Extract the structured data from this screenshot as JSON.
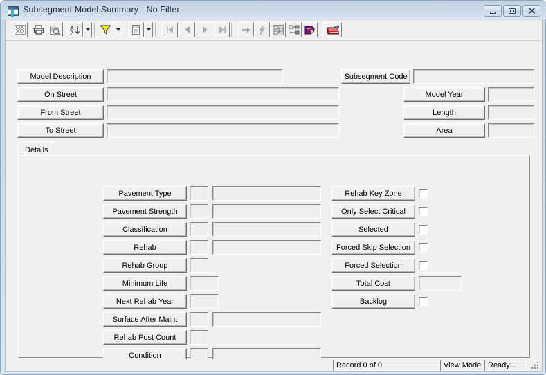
{
  "window": {
    "title": "Subsegment Model Summary - No Filter",
    "icon": "table-grid-icon",
    "controls": {
      "minimize": "Minimize",
      "maximize": "Maximize",
      "close": "Close"
    }
  },
  "toolbar": {
    "buttons": [
      {
        "name": "select-all-icon",
        "glyph": "grid"
      },
      {
        "name": "print-icon",
        "glyph": "printer"
      },
      {
        "name": "print-preview-icon",
        "glyph": "preview"
      },
      {
        "name": "sort-icon",
        "glyph": "sort"
      },
      {
        "name": "filter-icon",
        "glyph": "funnel"
      },
      {
        "name": "report-icon",
        "glyph": "document"
      },
      {
        "name": "first-record-icon",
        "glyph": "first"
      },
      {
        "name": "previous-record-icon",
        "glyph": "prev"
      },
      {
        "name": "next-record-icon",
        "glyph": "next"
      },
      {
        "name": "last-record-icon",
        "glyph": "last"
      },
      {
        "name": "goto-record-icon",
        "glyph": "arrow-right"
      },
      {
        "name": "lightning-icon",
        "glyph": "lightning"
      },
      {
        "name": "hierarchy-icon",
        "glyph": "hierarchy"
      },
      {
        "name": "tree-view-icon",
        "glyph": "tree"
      },
      {
        "name": "help-book-icon",
        "glyph": "book"
      },
      {
        "name": "map-icon",
        "glyph": "map"
      }
    ],
    "dropdown_label": "More options"
  },
  "header_form": {
    "left_fields": [
      {
        "label": "Model Description",
        "value": "",
        "placeholder": ""
      },
      {
        "label": "On Street",
        "value": "",
        "placeholder": ""
      },
      {
        "label": "From Street",
        "value": "",
        "placeholder": ""
      },
      {
        "label": "To Street",
        "value": "",
        "placeholder": ""
      }
    ],
    "right_fields": [
      {
        "label": "Subsegment Code",
        "value": "",
        "placeholder": ""
      },
      {
        "label": "Model Year",
        "value": "",
        "placeholder": ""
      },
      {
        "label": "Length",
        "value": "",
        "placeholder": ""
      },
      {
        "label": "Area",
        "value": "",
        "placeholder": ""
      }
    ]
  },
  "tabs": [
    {
      "label": "Details",
      "active": true
    }
  ],
  "details": {
    "left_column": [
      {
        "label": "Pavement Type",
        "code": "",
        "description": "",
        "has_description": true
      },
      {
        "label": "Pavement Strength",
        "code": "",
        "description": "",
        "has_description": true
      },
      {
        "label": "Classification",
        "code": "",
        "description": "",
        "has_description": true
      },
      {
        "label": "Rehab",
        "code": "",
        "description": "",
        "has_description": true
      },
      {
        "label": "Rehab Group",
        "code": "",
        "description": "",
        "has_description": false
      },
      {
        "label": "Minimum Life",
        "code": "",
        "description": "",
        "has_description": false,
        "wide_code": true
      },
      {
        "label": "Next Rehab Year",
        "code": "",
        "description": "",
        "has_description": false,
        "wide_code": true
      },
      {
        "label": "Surface After Maint",
        "code": "",
        "description": "",
        "has_description": true
      },
      {
        "label": "Rehab Post Count",
        "code": "",
        "description": "",
        "has_description": false
      },
      {
        "label": "Condition",
        "code": "",
        "description": "",
        "has_description": true
      }
    ],
    "right_column": [
      {
        "label": "Rehab Key Zone",
        "type": "checkbox",
        "checked": false
      },
      {
        "label": "Only Select Critical",
        "type": "checkbox",
        "checked": false
      },
      {
        "label": "Selected",
        "type": "checkbox",
        "checked": false
      },
      {
        "label": "Forced Skip Selection",
        "type": "checkbox",
        "checked": false
      },
      {
        "label": "Forced Selection",
        "type": "checkbox",
        "checked": false
      },
      {
        "label": "Total Cost",
        "type": "text",
        "value": ""
      },
      {
        "label": "Backlog",
        "type": "checkbox",
        "checked": false
      }
    ]
  },
  "statusbar": {
    "record_counter": "Record 0 of 0",
    "mode": "View Mode",
    "status": "Ready..."
  },
  "colors": {
    "window_frame": "#ccd9e8",
    "client_background": "#f0f0f0",
    "field_background": "#efefef",
    "text": "#000000",
    "title_text": "#1c2f45",
    "funnel_yellow": "#efef00",
    "book_purple": "#7b0f8f",
    "map_red": "#d42020"
  }
}
